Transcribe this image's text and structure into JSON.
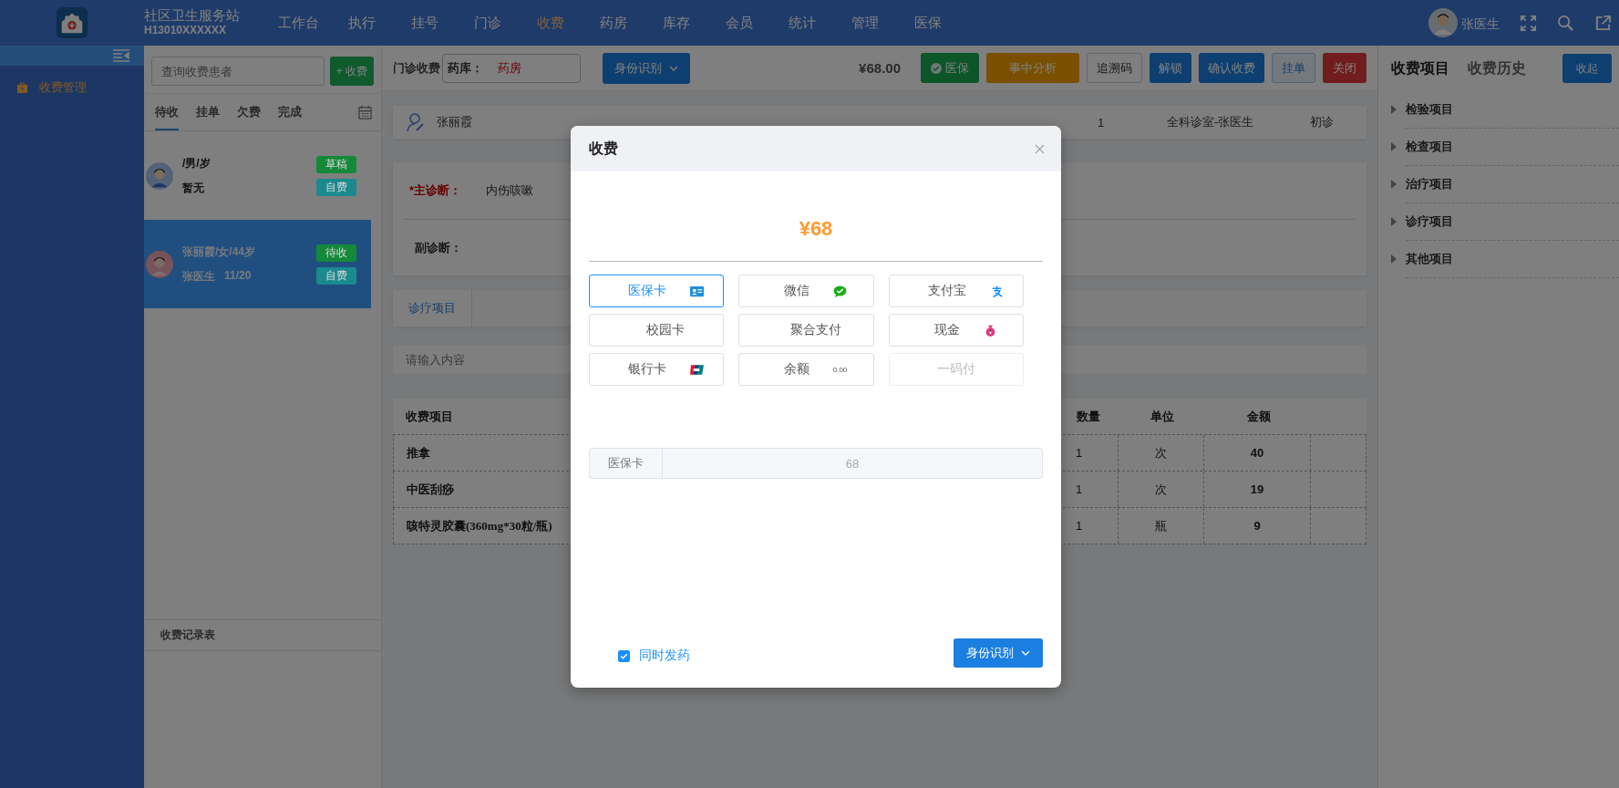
{
  "topbar": {
    "brand": "社区卫生服务站",
    "code": "H13010XXXXXX",
    "nav": [
      {
        "label": "工作台",
        "selected": false
      },
      {
        "label": "执行",
        "selected": false
      },
      {
        "label": "挂号",
        "selected": false
      },
      {
        "label": "门诊",
        "selected": false
      },
      {
        "label": "收费",
        "selected": true
      },
      {
        "label": "药房",
        "selected": false
      },
      {
        "label": "库存",
        "selected": false
      },
      {
        "label": "会员",
        "selected": false
      },
      {
        "label": "统计",
        "selected": false
      },
      {
        "label": "管理",
        "selected": false
      },
      {
        "label": "医保",
        "selected": false
      }
    ],
    "user": "张医生"
  },
  "sidebar": {
    "items": [
      {
        "label": "收费管理",
        "selected": true
      }
    ]
  },
  "patient_list": {
    "search": {
      "placeholder": "查询收费患者"
    },
    "add_button": "+ 收费",
    "tabs": [
      {
        "label": "待收",
        "selected": true
      },
      {
        "label": "挂单",
        "selected": false
      },
      {
        "label": "欠费",
        "selected": false
      },
      {
        "label": "完成",
        "selected": false
      }
    ],
    "patients": [
      {
        "line_1": "/男/岁",
        "line_2": "暂无",
        "tags": [
          {
            "label": "草稿",
            "color": "#14893a"
          },
          {
            "label": "自费",
            "color": "#1a8a8f"
          }
        ],
        "selected": false
      },
      {
        "line_1": "张丽霞/女/44岁",
        "line_2": "张医生",
        "date": "11/20",
        "tags": [
          {
            "label": "待收",
            "color": "#14893a"
          },
          {
            "label": "自费",
            "color": "#1a8a8f"
          }
        ],
        "selected": true
      }
    ],
    "footer": "收费记录表"
  },
  "toolbar": {
    "title": "门诊收费",
    "pharmacy": {
      "label": "药库：",
      "value": "药房"
    },
    "id_button": "身份识别",
    "total": "¥68.00",
    "buttons": [
      {
        "label": "医保",
        "kind": "success"
      },
      {
        "label": "事中分析",
        "kind": "warning"
      },
      {
        "label": "追溯码",
        "kind": "plain"
      },
      {
        "label": "解锁",
        "kind": "primary"
      },
      {
        "label": "确认收费",
        "kind": "primary"
      },
      {
        "label": "挂单",
        "kind": "info"
      },
      {
        "label": "关闭",
        "kind": "danger"
      }
    ]
  },
  "patient_info": {
    "name": "张丽霞",
    "fields": [
      "1",
      "全科诊室-张医生",
      "初诊"
    ]
  },
  "diagnosis": {
    "main_label": "*主诊断：",
    "main_value": "内伤咳嗽",
    "secondary_label": "副诊断："
  },
  "item_tabs": [
    {
      "label": "诊疗项目",
      "selected": true
    }
  ],
  "item_search": {
    "placeholder": "请输入内容"
  },
  "table": {
    "columns": [
      "收费项目",
      "数量",
      "单位",
      "金额"
    ],
    "rows": [
      [
        "推拿",
        "1",
        "次",
        "40"
      ],
      [
        "中医刮痧",
        "1",
        "次",
        "19"
      ],
      [
        "咳特灵胶囊(360mg*30粒/瓶)",
        "1",
        "瓶",
        "9"
      ]
    ]
  },
  "right_panel": {
    "tabs": [
      {
        "label": "收费项目",
        "selected": true
      },
      {
        "label": "收费历史",
        "selected": false
      }
    ],
    "collapse_button": "收起",
    "categories": [
      {
        "label": "检验项目",
        "expanded": false
      },
      {
        "label": "检查项目",
        "expanded": false
      },
      {
        "label": "治疗项目",
        "expanded": false
      },
      {
        "label": "诊疗项目",
        "expanded": false
      },
      {
        "label": "其他项目",
        "expanded": false
      }
    ]
  },
  "dialog": {
    "title": "收费",
    "amount": "¥68",
    "methods": [
      {
        "label": "医保卡",
        "selected": true,
        "disabled": false
      },
      {
        "label": "微信",
        "selected": false,
        "disabled": false
      },
      {
        "label": "支付宝",
        "selected": false,
        "disabled": false
      },
      {
        "label": "校园卡",
        "selected": false,
        "disabled": false
      },
      {
        "label": "聚合支付",
        "selected": false,
        "disabled": false
      },
      {
        "label": "现金",
        "selected": false,
        "disabled": false
      },
      {
        "label": "银行卡",
        "selected": false,
        "disabled": false
      },
      {
        "label": "余额",
        "selected": false,
        "disabled": false,
        "note": "0.00"
      },
      {
        "label": "一码付",
        "selected": false,
        "disabled": true
      }
    ],
    "method_field": {
      "label": "医保卡",
      "value": "68"
    },
    "dispense": {
      "label": "同时发药",
      "checked": true
    },
    "id_button": "身份识别"
  }
}
